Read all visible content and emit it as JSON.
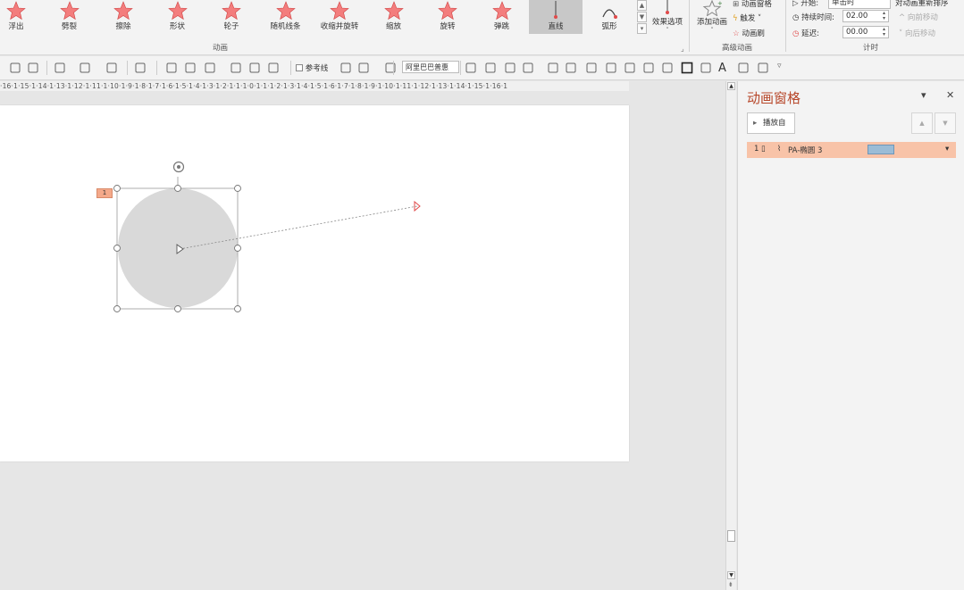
{
  "ribbon": {
    "animations": [
      {
        "label": "浮出",
        "icon": "float-in-star-icon"
      },
      {
        "label": "劈裂",
        "icon": "split-star-icon"
      },
      {
        "label": "擦除",
        "icon": "wipe-star-icon"
      },
      {
        "label": "形状",
        "icon": "shape-star-icon"
      },
      {
        "label": "轮子",
        "icon": "wheel-star-icon"
      },
      {
        "label": "随机线条",
        "icon": "random-bars-star-icon"
      },
      {
        "label": "收缩并旋转",
        "icon": "shrink-turn-star-icon"
      },
      {
        "label": "缩放",
        "icon": "zoom-star-icon"
      },
      {
        "label": "旋转",
        "icon": "spin-star-icon"
      },
      {
        "label": "弹跳",
        "icon": "bounce-star-icon"
      },
      {
        "label": "直线",
        "icon": "line-path-icon",
        "selected": true
      },
      {
        "label": "弧形",
        "icon": "arc-path-icon"
      }
    ],
    "effect_options_label": "效果选项",
    "animation_group_label": "动画",
    "add_animation_label": "添加动画",
    "animation_pane_label": "动画窗格",
    "trigger_label": "触发",
    "animation_painter_label": "动画刷",
    "advanced_group_label": "高级动画",
    "start_label": "开始:",
    "start_value": "单击时",
    "duration_label": "持续时间:",
    "duration_value": "02.00",
    "delay_label": "延迟:",
    "delay_value": "00.00",
    "reorder_label": "对动画重新排序",
    "move_earlier_label": "向前移动",
    "move_later_label": "向后移动",
    "timing_group_label": "计时"
  },
  "toolbar": {
    "guides_label": "参考线",
    "font_value": "阿里巴巴普惠"
  },
  "ruler": {
    "text": "·16·1·15·1·14·1·13·1·12·1·11·1·10·1·9·1·8·1·7·1·6·1·5·1·4·1·3·1·2·1·1·1·0·1·1·1·2·1·3·1·4·1·5·1·6·1·7·1·8·1·9·1·10·1·11·1·12·1·13·1·14·1·15·1·16·1"
  },
  "slide": {
    "animation_tag": "1"
  },
  "pane": {
    "title": "动画窗格",
    "play_from_label": "播放自",
    "item": {
      "index": "1",
      "name": "PA-椭圆 3"
    }
  },
  "colors": {
    "star_fill": "#f37d7d",
    "pane_title": "#b7472a",
    "selected_row": "#f8c3a8",
    "timing_bar": "#9bbcd6",
    "circle_fill": "#d9d9d9"
  }
}
